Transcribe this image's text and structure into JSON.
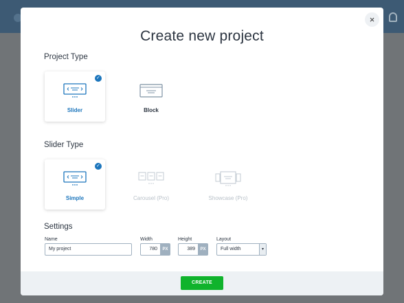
{
  "modal": {
    "title": "Create new project",
    "close_label": "×"
  },
  "project_type": {
    "heading": "Project Type",
    "options": [
      {
        "label": "Slider",
        "selected": true
      },
      {
        "label": "Block",
        "selected": false
      }
    ]
  },
  "slider_type": {
    "heading": "Slider Type",
    "options": [
      {
        "label": "Simple",
        "selected": true,
        "disabled": false
      },
      {
        "label": "Carousel (Pro)",
        "selected": false,
        "disabled": true
      },
      {
        "label": "Showcase (Pro)",
        "selected": false,
        "disabled": true
      }
    ]
  },
  "settings": {
    "heading": "Settings",
    "name_label": "Name",
    "name_value": "My project",
    "width_label": "Width",
    "width_value": "780",
    "width_unit": "PX",
    "height_label": "Height",
    "height_value": "389",
    "height_unit": "PX",
    "layout_label": "Layout",
    "layout_value": "Full width",
    "layout_arrow": "▾"
  },
  "footer": {
    "create_label": "CREATE"
  },
  "check_glyph": "✓",
  "colors": {
    "accent": "#1b75bc",
    "create_button": "#10b32c"
  }
}
